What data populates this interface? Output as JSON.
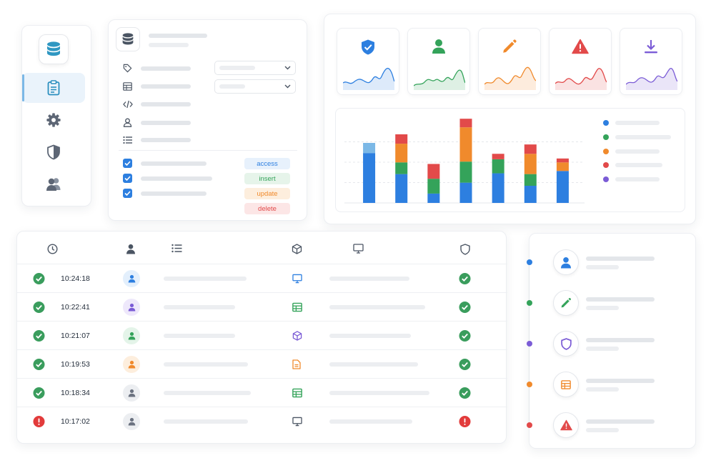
{
  "sidebar": {
    "items": [
      {
        "icon": "database-icon",
        "active": false
      },
      {
        "icon": "clipboard-icon",
        "active": true
      },
      {
        "icon": "gear-icon",
        "active": false
      },
      {
        "icon": "shield-icon",
        "active": false
      },
      {
        "icon": "users-icon",
        "active": false
      }
    ]
  },
  "permissions": {
    "header_icon": "database-icon",
    "fields": [
      "tag-icon",
      "table-icon",
      "code-icon",
      "user-icon",
      "list-icon"
    ],
    "checkboxes_checked": [
      true,
      true,
      true
    ],
    "badges": {
      "access": "access",
      "insert": "insert",
      "update": "update",
      "delete": "delete"
    }
  },
  "metrics": {
    "tiles": [
      {
        "icon": "shield-check-icon",
        "color": "#2d7fe0"
      },
      {
        "icon": "user-icon",
        "color": "#34a35a"
      },
      {
        "icon": "pencil-icon",
        "color": "#f08a2c"
      },
      {
        "icon": "warning-icon",
        "color": "#e24a4a"
      },
      {
        "icon": "download-icon",
        "color": "#7b5cd6"
      }
    ],
    "legend_colors": [
      "#2d7fe0",
      "#34a35a",
      "#f08a2c",
      "#e24a4a",
      "#7b5cd6"
    ]
  },
  "chart_data": {
    "type": "bar",
    "stacked": true,
    "categories": [
      "",
      "",
      "",
      "",
      "",
      "",
      ""
    ],
    "series": [
      {
        "color": "#2d7fe0",
        "values": [
          64,
          37,
          12,
          26,
          38,
          22,
          41
        ]
      },
      {
        "color": "#34a35a",
        "values": [
          0,
          15,
          19,
          27,
          18,
          15,
          0
        ]
      },
      {
        "color": "#f08a2c",
        "values": [
          0,
          24,
          0,
          44,
          0,
          26,
          11
        ]
      },
      {
        "color": "#e24a4a",
        "values": [
          0,
          12,
          19,
          11,
          7,
          12,
          5
        ]
      },
      {
        "color": "#7bb8e6",
        "values": [
          13,
          0,
          0,
          0,
          0,
          0,
          0
        ]
      }
    ],
    "ylim": [
      0,
      110
    ],
    "grid": true,
    "legend": "right"
  },
  "log": {
    "header_icons": [
      "clock-icon",
      "user-icon",
      "list-icon",
      "box-icon",
      "monitor-icon",
      "shield-icon"
    ],
    "rows": [
      {
        "status": "ok",
        "time": "10:24:18",
        "avatar_color": "#2d7fe0",
        "avatar_bg": "#e3effc",
        "resource_icon": "monitor-icon",
        "resource_color": "#2d7fe0",
        "result": "ok"
      },
      {
        "status": "ok",
        "time": "10:22:41",
        "avatar_color": "#7b5cd6",
        "avatar_bg": "#eee8fb",
        "resource_icon": "table-icon",
        "resource_color": "#34a35a",
        "result": "ok"
      },
      {
        "status": "ok",
        "time": "10:21:07",
        "avatar_color": "#34a35a",
        "avatar_bg": "#e4f4e9",
        "resource_icon": "box-icon",
        "resource_color": "#7b5cd6",
        "result": "ok"
      },
      {
        "status": "ok",
        "time": "10:19:53",
        "avatar_color": "#f08a2c",
        "avatar_bg": "#fdeedd",
        "resource_icon": "document-icon",
        "resource_color": "#f08a2c",
        "result": "ok"
      },
      {
        "status": "ok",
        "time": "10:18:34",
        "avatar_color": "#6b7280",
        "avatar_bg": "#eceef1",
        "resource_icon": "table-icon",
        "resource_color": "#34a35a",
        "result": "ok"
      },
      {
        "status": "error",
        "time": "10:17:02",
        "avatar_color": "#6b7280",
        "avatar_bg": "#eceef1",
        "resource_icon": "monitor-icon",
        "resource_color": "#4b5563",
        "result": "error"
      }
    ]
  },
  "timeline": {
    "items": [
      {
        "dot_color": "#2d7fe0",
        "icon": "user-icon",
        "icon_color": "#2d7fe0"
      },
      {
        "dot_color": "#34a35a",
        "icon": "pencil-icon",
        "icon_color": "#34a35a"
      },
      {
        "dot_color": "#7b5cd6",
        "icon": "shield-icon",
        "icon_color": "#7b5cd6"
      },
      {
        "dot_color": "#f08a2c",
        "icon": "table-icon",
        "icon_color": "#f08a2c"
      },
      {
        "dot_color": "#e24a4a",
        "icon": "warning-icon",
        "icon_color": "#e24a4a"
      }
    ]
  }
}
